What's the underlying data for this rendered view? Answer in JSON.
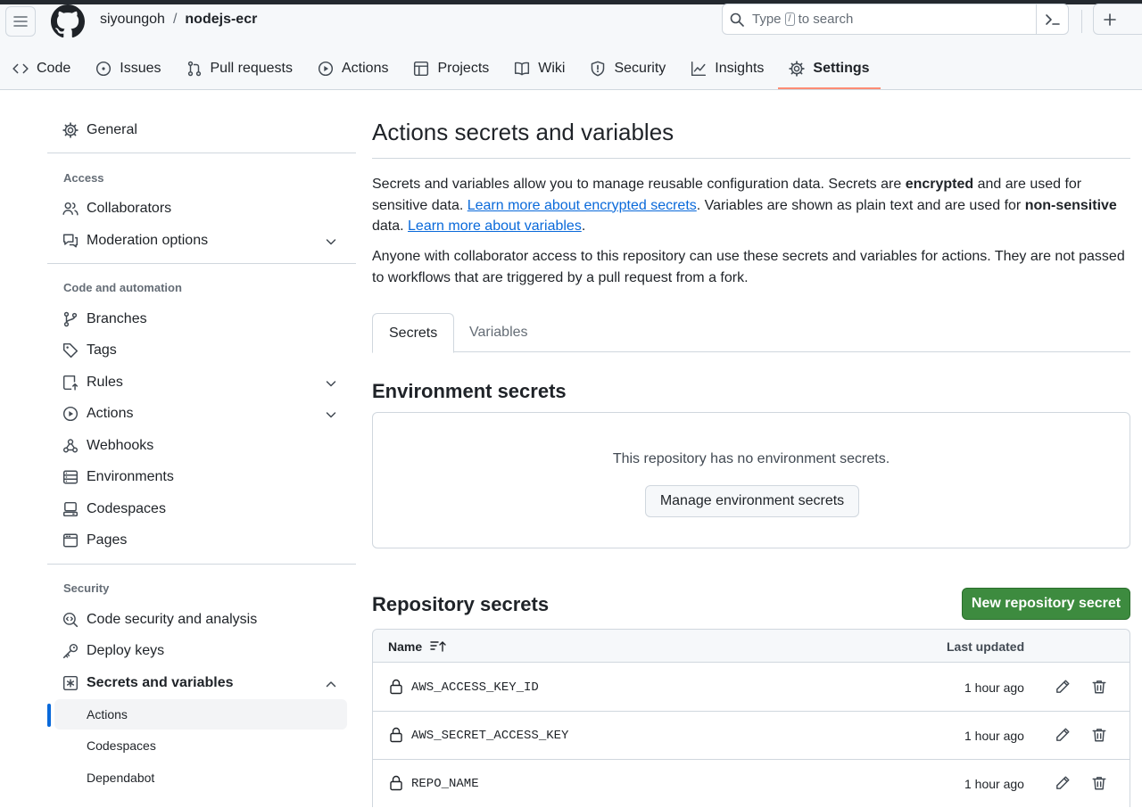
{
  "header": {
    "owner": "siyoungoh",
    "separator": "/",
    "repo": "nodejs-ecr",
    "search_prefix": "Type",
    "search_key": "/",
    "search_suffix": "to search"
  },
  "repo_tabs": [
    {
      "label": "Code",
      "icon": "code-icon"
    },
    {
      "label": "Issues",
      "icon": "issue-icon"
    },
    {
      "label": "Pull requests",
      "icon": "pull-request-icon"
    },
    {
      "label": "Actions",
      "icon": "play-icon"
    },
    {
      "label": "Projects",
      "icon": "table-icon"
    },
    {
      "label": "Wiki",
      "icon": "book-icon"
    },
    {
      "label": "Security",
      "icon": "shield-icon"
    },
    {
      "label": "Insights",
      "icon": "graph-icon"
    },
    {
      "label": "Settings",
      "icon": "gear-icon",
      "active": true
    }
  ],
  "sidebar": {
    "general": "General",
    "access_heading": "Access",
    "collaborators": "Collaborators",
    "moderation": "Moderation options",
    "code_heading": "Code and automation",
    "branches": "Branches",
    "tags": "Tags",
    "rules": "Rules",
    "actions": "Actions",
    "webhooks": "Webhooks",
    "environments": "Environments",
    "codespaces": "Codespaces",
    "pages": "Pages",
    "security_heading": "Security",
    "code_security": "Code security and analysis",
    "deploy_keys": "Deploy keys",
    "secrets_vars": "Secrets and variables",
    "sub_actions": "Actions",
    "sub_codespaces": "Codespaces",
    "sub_dependabot": "Dependabot"
  },
  "main": {
    "title": "Actions secrets and variables",
    "p1_a": "Secrets and variables allow you to manage reusable configuration data. Secrets are ",
    "p1_b": "encrypted",
    "p1_c": " and are used for sensitive data. ",
    "p1_link1": "Learn more about encrypted secrets",
    "p1_d": ". Variables are shown as plain text and are used for ",
    "p1_e": "non-sensitive",
    "p1_f": " data. ",
    "p1_link2": "Learn more about variables",
    "p1_g": ".",
    "p2": "Anyone with collaborator access to this repository can use these secrets and variables for actions. They are not passed to workflows that are triggered by a pull request from a fork.",
    "tab_secrets": "Secrets",
    "tab_variables": "Variables",
    "env_heading": "Environment secrets",
    "env_empty": "This repository has no environment secrets.",
    "env_button": "Manage environment secrets",
    "repo_heading": "Repository secrets",
    "new_button": "New repository secret",
    "col_name": "Name",
    "col_updated": "Last updated",
    "secrets": [
      {
        "name": "AWS_ACCESS_KEY_ID",
        "updated": "1 hour ago"
      },
      {
        "name": "AWS_SECRET_ACCESS_KEY",
        "updated": "1 hour ago"
      },
      {
        "name": "REPO_NAME",
        "updated": "1 hour ago"
      }
    ]
  },
  "colors": {
    "accent_link": "#0969da",
    "active_tab_underline": "#fd8c73",
    "primary_button": "#3d8b3f"
  }
}
